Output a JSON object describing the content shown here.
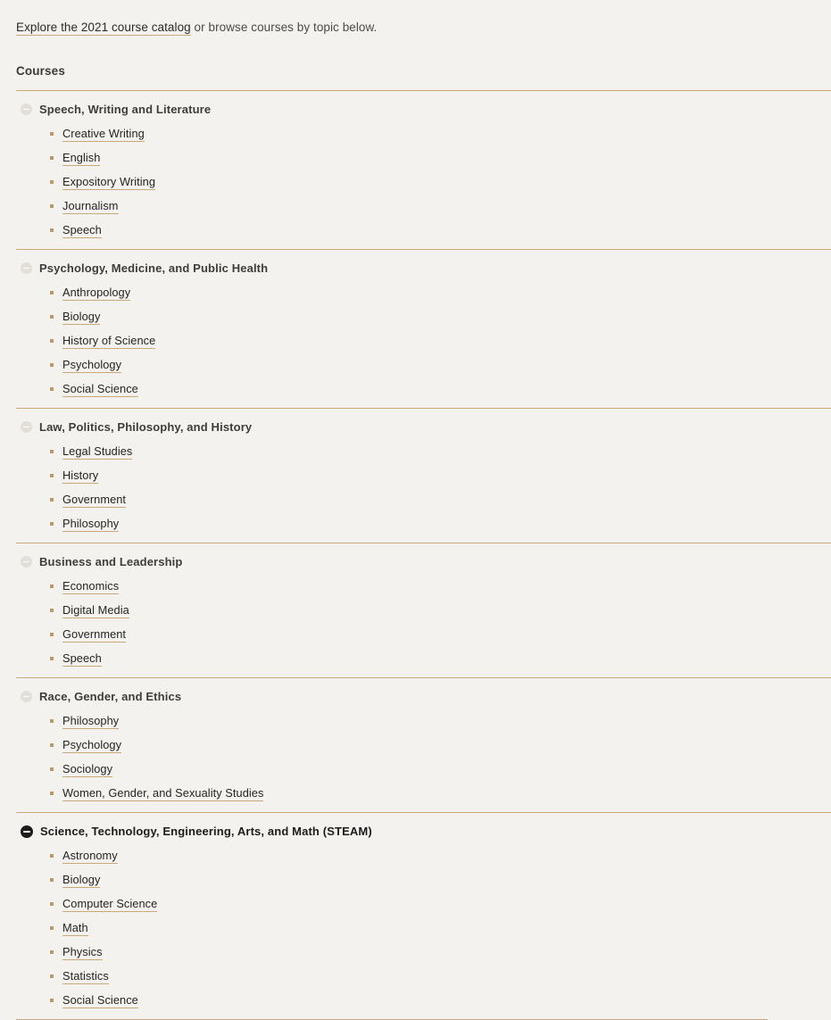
{
  "intro": {
    "link_text": "Explore the 2021 course catalog",
    "rest_text": " or browse courses by topic below."
  },
  "courses_heading": "Courses",
  "icons": {
    "collapsed": "minus-circle-icon",
    "expanded": "minus-circle-filled-icon",
    "bullet": "bullet-dot-icon"
  },
  "colors": {
    "background": "#f4f2ee",
    "rule": "#c9a97c",
    "bullet": "#b79a6e",
    "link_underline": "#c9a97c",
    "text": "#2b2b2b",
    "toggle_collapsed": "#e2dfd8",
    "toggle_expanded": "#1c1c1c"
  },
  "accordion": {
    "sections": [
      {
        "title": "Speech, Writing and Literature",
        "expanded": false,
        "items": [
          "Creative Writing",
          "English",
          "Expository Writing",
          "Journalism",
          "Speech"
        ]
      },
      {
        "title": "Psychology, Medicine, and Public Health",
        "expanded": false,
        "items": [
          "Anthropology",
          "Biology",
          "History of Science",
          "Psychology",
          "Social Science"
        ]
      },
      {
        "title": "Law, Politics, Philosophy, and History",
        "expanded": false,
        "items": [
          "Legal Studies",
          "History",
          "Government",
          "Philosophy"
        ]
      },
      {
        "title": "Business and Leadership",
        "expanded": false,
        "items": [
          "Economics",
          "Digital Media",
          "Government",
          "Speech"
        ]
      },
      {
        "title": "Race, Gender, and Ethics",
        "expanded": false,
        "items": [
          "Philosophy",
          "Psychology",
          "Sociology",
          "Women, Gender, and Sexuality Studies"
        ]
      },
      {
        "title": "Science, Technology, Engineering, Arts, and Math (STEAM)",
        "expanded": true,
        "items": [
          "Astronomy",
          "Biology",
          "Computer Science",
          "Math",
          "Physics",
          "Statistics",
          "Social Science"
        ]
      }
    ]
  }
}
